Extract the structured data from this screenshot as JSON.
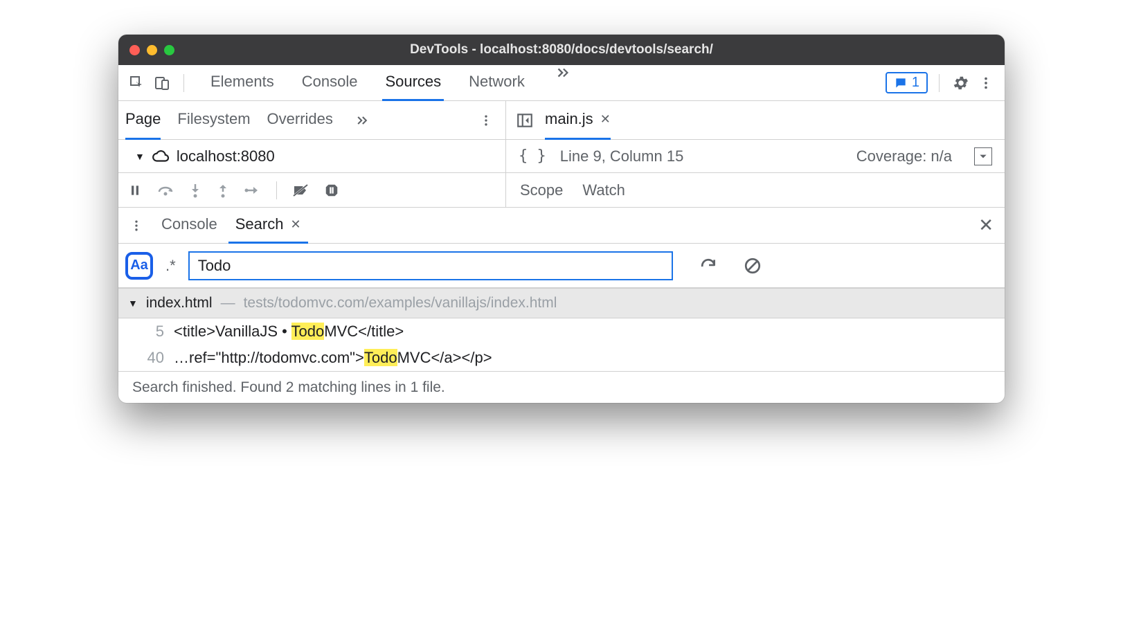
{
  "window": {
    "title": "DevTools - localhost:8080/docs/devtools/search/"
  },
  "toolbar": {
    "tabs": [
      "Elements",
      "Console",
      "Sources",
      "Network"
    ],
    "active_tab": "Sources",
    "feedback_count": "1"
  },
  "sources_nav": {
    "tabs": [
      "Page",
      "Filesystem",
      "Overrides"
    ],
    "active": "Page"
  },
  "editor": {
    "file_tab": "main.js",
    "cursor_status": "Line 9, Column 15",
    "coverage": "Coverage: n/a"
  },
  "tree": {
    "host": "localhost:8080"
  },
  "debug_sidebar": {
    "tabs": [
      "Scope",
      "Watch"
    ]
  },
  "drawer": {
    "tabs": [
      "Console",
      "Search"
    ],
    "active": "Search"
  },
  "search": {
    "case_label": "Aa",
    "regex_label": ".*",
    "query": "Todo"
  },
  "results": {
    "file": {
      "name": "index.html",
      "dash": "—",
      "path": "tests/todomvc.com/examples/vanillajs/index.html"
    },
    "lines": [
      {
        "ln": "5",
        "pre": "<title>VanillaJS • ",
        "match": "Todo",
        "post": "MVC</title>"
      },
      {
        "ln": "40",
        "pre": "…ref=\"http://todomvc.com\">",
        "match": "Todo",
        "post": "MVC</a></p>"
      }
    ]
  },
  "status": "Search finished.  Found 2 matching lines in 1 file."
}
